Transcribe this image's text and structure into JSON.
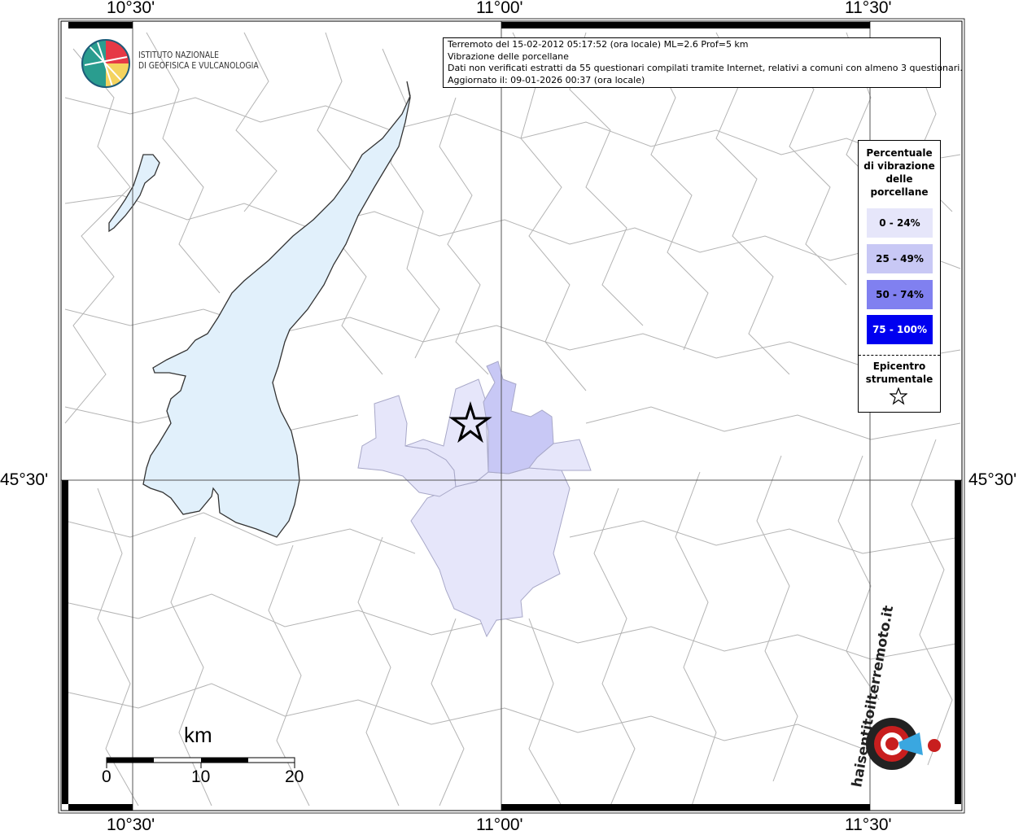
{
  "map": {
    "longitude_labels": [
      "10°30'",
      "11°00'",
      "11°30'"
    ],
    "latitude_labels": [
      "45°30'",
      "45°30'"
    ],
    "colors": {
      "lake": "#e1f0fb",
      "class_0_24": "#e6e6fa",
      "class_25_49": "#c8c8f5",
      "class_50_74": "#8080f0",
      "class_75_100": "#0000f0",
      "boundary": "#b0b0b0"
    }
  },
  "logo": {
    "line1": "ISTITUTO NAZIONALE",
    "line2": "DI GEOFISICA E VULCANOLOGIA"
  },
  "info": {
    "line1": "Terremoto del 15-02-2012 05:17:52 (ora locale) ML=2.6 Prof=5 km",
    "line2": "Vibrazione delle porcellane",
    "line3": "Dati non verificati estratti da 55 questionari compilati tramite Internet, relativi a comuni con almeno 3 questionari.",
    "line4": "Aggiornato il: 09-01-2026 00:37 (ora locale)"
  },
  "legend": {
    "title_lines": [
      "Percentuale",
      "di vibrazione",
      "delle",
      "porcellane"
    ],
    "classes": [
      "0 - 24%",
      "25 - 49%",
      "50 - 74%",
      "75 - 100%"
    ],
    "epicenter_lines": [
      "Epicentro",
      "strumentale"
    ],
    "epicenter_icon": "star-outline-icon"
  },
  "scale": {
    "unit": "km",
    "ticks": [
      "0",
      "10",
      "20"
    ]
  },
  "watermark": {
    "text": "haisentitoilterremoto.it",
    "icon": "target-megaphone-icon"
  }
}
